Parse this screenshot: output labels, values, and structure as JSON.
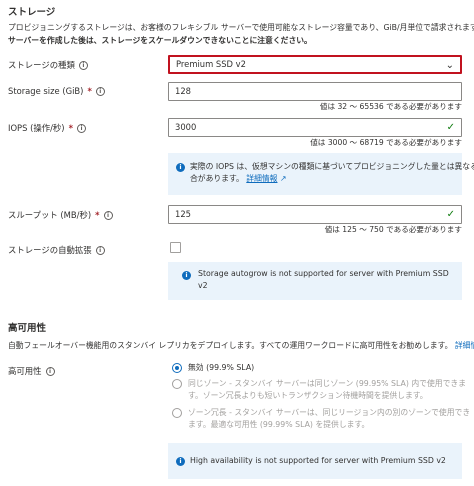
{
  "storage": {
    "title": "ストレージ",
    "desc_line1": "プロビジョニングするストレージは、お客様のフレキシブル サーバーで使用可能なストレージ容量であり、GiB/月単位で請求されます。",
    "desc_line2": "サーバーを作成した後は、ストレージをスケールダウンできないことに注意ください。",
    "type_label": "ストレージの種類",
    "type_value": "Premium SSD v2",
    "size_label": "Storage size (GiB)",
    "size_value": "128",
    "size_hint": "値は 32 ～ 65536 である必要があります",
    "iops_label": "IOPS (操作/秒)",
    "iops_value": "3000",
    "iops_hint": "値は 3000 ～ 68719 である必要があります",
    "iops_info_line1": "実際の IOPS は、仮想マシンの種類に基づいてプロビジョニングした量とは異なる場",
    "iops_info_line2": "合があります。",
    "iops_info_link": "詳細情報",
    "throughput_label": "スループット (MB/秒)",
    "throughput_value": "125",
    "throughput_hint": "値は 125 ～ 750 である必要があります",
    "autogrow_label": "ストレージの自動拡張",
    "autogrow_info_line1": "Storage autogrow is not supported for server with Premium SSD",
    "autogrow_info_line2": "v2",
    "required_mark": "*"
  },
  "ha": {
    "title": "高可用性",
    "desc": "自動フェールオーバー機能用のスタンバイ レプリカをデプロイします。すべての運用ワークロードに高可用性をお勧めします。",
    "desc_link": "詳細情報",
    "label": "高可用性",
    "options": [
      {
        "lines": [
          "無効 (99.9% SLA)"
        ],
        "selected": true,
        "disabled": false
      },
      {
        "lines": [
          "同じゾーン - スタンバイ サーバーは同じゾーン (99.95% SLA) 内で使用できま",
          "す。ゾーン冗長よりも短いトランザクション待機時間を提供します。"
        ],
        "selected": false,
        "disabled": true
      },
      {
        "lines": [
          "ゾーン冗長 - スタンバイ サーバーは、同じリージョン内の別のゾーンで使用でき",
          "ます。最適な可用性 (99.99% SLA) を提供します。"
        ],
        "selected": false,
        "disabled": true
      }
    ],
    "info": "High availability is not supported for server with Premium SSD v2"
  },
  "icons": {
    "info": "i",
    "chevron": "⌄",
    "check": "✓",
    "external": "↗"
  }
}
